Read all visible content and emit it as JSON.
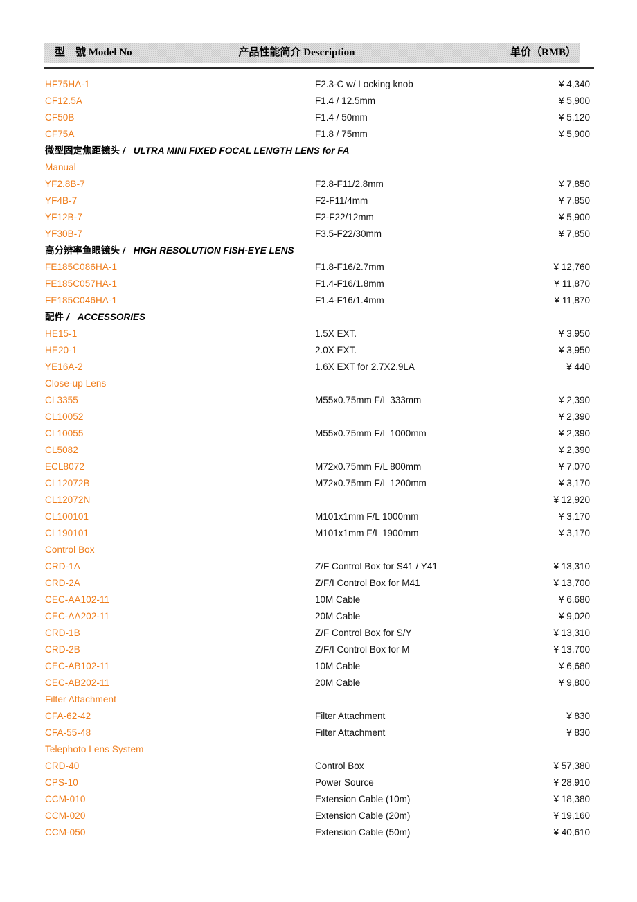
{
  "header": {
    "model_col": "型　號 Model No",
    "description_col": "产品性能简介 Description",
    "price_col": "单价（RMB）"
  },
  "currency_symbol": "¥",
  "colors": {
    "model_text": "#ef7c1a",
    "header_band": "#c9c9c9",
    "body_text": "#111111",
    "rule": "#2b2b2b"
  },
  "rows": [
    {
      "type": "item",
      "model": "HF75HA-1",
      "desc": "F2.3-C w/ Locking knob",
      "price": "¥ 4,340"
    },
    {
      "type": "item",
      "model": "CF12.5A",
      "desc": "F1.4 / 12.5mm",
      "price": "¥ 5,900"
    },
    {
      "type": "item",
      "model": "CF50B",
      "desc": "F1.4 / 50mm",
      "price": "¥ 5,120"
    },
    {
      "type": "item",
      "model": "CF75A",
      "desc": "F1.8 / 75mm",
      "price": "¥ 5,900"
    },
    {
      "type": "section",
      "cn": "微型固定焦距镜头",
      "sep": "/",
      "en": "ULTRA MINI FIXED FOCAL LENGTH LENS for FA",
      "desc": "",
      "price": ""
    },
    {
      "type": "group",
      "model": "Manual",
      "desc": "",
      "price": ""
    },
    {
      "type": "item",
      "model": "YF2.8B-7",
      "desc": "F2.8-F11/2.8mm",
      "price": "¥ 7,850"
    },
    {
      "type": "item",
      "model": "YF4B-7",
      "desc": "F2-F11/4mm",
      "price": "¥ 7,850"
    },
    {
      "type": "item",
      "model": "YF12B-7",
      "desc": "F2-F22/12mm",
      "price": "¥ 5,900"
    },
    {
      "type": "item",
      "model": "YF30B-7",
      "desc": "F3.5-F22/30mm",
      "price": "¥ 7,850"
    },
    {
      "type": "section",
      "cn": "高分辨率鱼眼镜头",
      "sep": "/",
      "en": "HIGH RESOLUTION FISH-EYE LENS",
      "desc": "",
      "price": ""
    },
    {
      "type": "item",
      "model": "FE185C086HA-1",
      "desc": "F1.8-F16/2.7mm",
      "price": "¥ 12,760"
    },
    {
      "type": "item",
      "model": "FE185C057HA-1",
      "desc": "F1.4-F16/1.8mm",
      "price": "¥ 11,870"
    },
    {
      "type": "item",
      "model": "FE185C046HA-1",
      "desc": "F1.4-F16/1.4mm",
      "price": "¥ 11,870"
    },
    {
      "type": "section",
      "cn": "配件",
      "sep": "/",
      "en": "ACCESSORIES",
      "desc": "",
      "price": ""
    },
    {
      "type": "item",
      "model": "HE15-1",
      "desc": "1.5X EXT.",
      "price": "¥ 3,950"
    },
    {
      "type": "item",
      "model": "HE20-1",
      "desc": "2.0X EXT.",
      "price": "¥ 3,950"
    },
    {
      "type": "item",
      "model": "YE16A-2",
      "desc": "1.6X EXT for 2.7X2.9LA",
      "price": "¥ 440"
    },
    {
      "type": "group",
      "model": "Close-up Lens",
      "desc": "",
      "price": ""
    },
    {
      "type": "item",
      "model": "CL3355",
      "desc": "M55x0.75mm F/L 333mm",
      "price": "¥ 2,390"
    },
    {
      "type": "item",
      "model": "CL10052",
      "desc": "",
      "price": "¥ 2,390"
    },
    {
      "type": "item",
      "model": "CL10055",
      "desc": "M55x0.75mm F/L 1000mm",
      "price": "¥ 2,390"
    },
    {
      "type": "item",
      "model": "CL5082",
      "desc": "",
      "price": "¥ 2,390"
    },
    {
      "type": "item",
      "model": "ECL8072",
      "desc": "M72x0.75mm F/L 800mm",
      "price": "¥ 7,070"
    },
    {
      "type": "item",
      "model": "CL12072B",
      "desc": "M72x0.75mm F/L 1200mm",
      "price": "¥ 3,170"
    },
    {
      "type": "item",
      "model": "CL12072N",
      "desc": "",
      "price": "¥ 12,920"
    },
    {
      "type": "item",
      "model": "CL100101",
      "desc": "M101x1mm F/L 1000mm",
      "price": "¥ 3,170"
    },
    {
      "type": "item",
      "model": "CL190101",
      "desc": "M101x1mm F/L 1900mm",
      "price": "¥ 3,170"
    },
    {
      "type": "group",
      "model": "Control Box",
      "desc": "",
      "price": ""
    },
    {
      "type": "item",
      "model": "CRD-1A",
      "desc": "Z/F Control Box for S41 / Y41",
      "price": "¥ 13,310"
    },
    {
      "type": "item",
      "model": "CRD-2A",
      "desc": "Z/F/I Control Box for M41",
      "price": "¥ 13,700"
    },
    {
      "type": "item",
      "model": "CEC-AA102-11",
      "desc": "10M Cable",
      "price": "¥ 6,680"
    },
    {
      "type": "item",
      "model": "CEC-AA202-11",
      "desc": "20M Cable",
      "price": "¥ 9,020"
    },
    {
      "type": "item",
      "model": "CRD-1B",
      "desc": "Z/F Control Box for S/Y",
      "price": "¥ 13,310"
    },
    {
      "type": "item",
      "model": "CRD-2B",
      "desc": "Z/F/I Control Box for M",
      "price": "¥ 13,700"
    },
    {
      "type": "item",
      "model": "CEC-AB102-11",
      "desc": "10M Cable",
      "price": "¥ 6,680"
    },
    {
      "type": "item",
      "model": "CEC-AB202-11",
      "desc": "20M Cable",
      "price": "¥ 9,800"
    },
    {
      "type": "group",
      "model": "Filter Attachment",
      "desc": "",
      "price": ""
    },
    {
      "type": "item",
      "model": "CFA-62-42",
      "desc": "Filter Attachment",
      "price": "¥ 830"
    },
    {
      "type": "item",
      "model": "CFA-55-48",
      "desc": "Filter Attachment",
      "price": "¥ 830"
    },
    {
      "type": "group",
      "model": "Telephoto Lens System",
      "desc": "",
      "price": ""
    },
    {
      "type": "item",
      "model": "CRD-40",
      "desc": "Control Box",
      "price": "¥ 57,380"
    },
    {
      "type": "item",
      "model": "CPS-10",
      "desc": "Power Source",
      "price": "¥ 28,910"
    },
    {
      "type": "item",
      "model": "CCM-010",
      "desc": "Extension Cable (10m)",
      "price": "¥ 18,380"
    },
    {
      "type": "item",
      "model": "CCM-020",
      "desc": "Extension Cable (20m)",
      "price": "¥ 19,160"
    },
    {
      "type": "item",
      "model": "CCM-050",
      "desc": "Extension Cable (50m)",
      "price": "¥ 40,610"
    }
  ]
}
